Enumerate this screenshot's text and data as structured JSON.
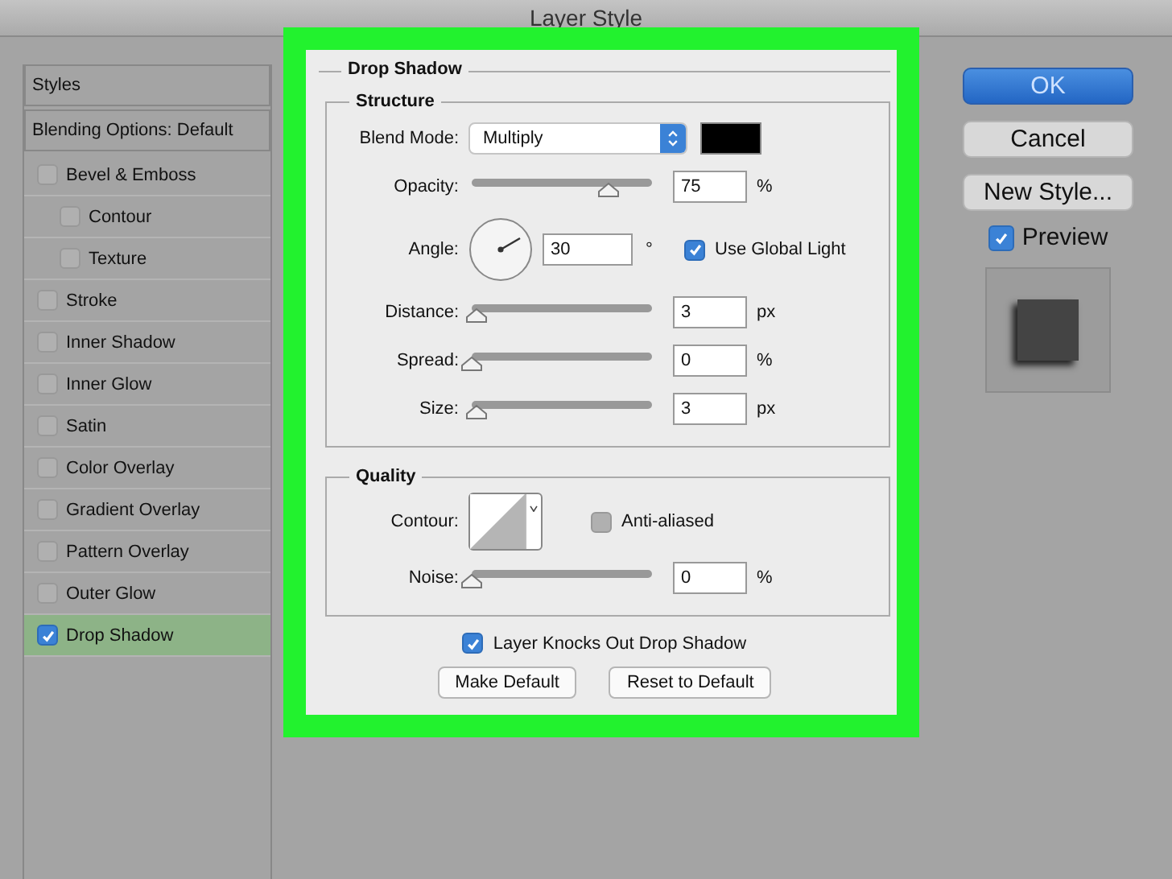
{
  "window": {
    "title": "Layer Style"
  },
  "sidebar": {
    "items": [
      {
        "label": "Styles",
        "kind": "header"
      },
      {
        "label": "Blending Options: Default",
        "kind": "header"
      },
      {
        "label": "Bevel & Emboss",
        "kind": "effect",
        "checked": false,
        "selected": false,
        "children": [
          {
            "label": "Contour",
            "kind": "effect",
            "checked": false,
            "selected": false
          },
          {
            "label": "Texture",
            "kind": "effect",
            "checked": false,
            "selected": false
          }
        ]
      },
      {
        "label": "Stroke",
        "kind": "effect",
        "checked": false,
        "selected": false
      },
      {
        "label": "Inner Shadow",
        "kind": "effect",
        "checked": false,
        "selected": false
      },
      {
        "label": "Inner Glow",
        "kind": "effect",
        "checked": false,
        "selected": false
      },
      {
        "label": "Satin",
        "kind": "effect",
        "checked": false,
        "selected": false
      },
      {
        "label": "Color Overlay",
        "kind": "effect",
        "checked": false,
        "selected": false
      },
      {
        "label": "Gradient Overlay",
        "kind": "effect",
        "checked": false,
        "selected": false
      },
      {
        "label": "Pattern Overlay",
        "kind": "effect",
        "checked": false,
        "selected": false
      },
      {
        "label": "Outer Glow",
        "kind": "effect",
        "checked": false,
        "selected": false
      },
      {
        "label": "Drop Shadow",
        "kind": "effect",
        "checked": true,
        "selected": true
      }
    ]
  },
  "drop_shadow": {
    "title": "Drop Shadow",
    "structure": {
      "title": "Structure",
      "rows": [
        {
          "kind": "select",
          "label": "Blend Mode:",
          "value": "Multiply",
          "color": "#000000"
        },
        {
          "kind": "slider",
          "label": "Opacity:",
          "level": 0.76,
          "value": "75",
          "unit": "%"
        },
        {
          "kind": "angle",
          "label": "Angle:",
          "value": "30",
          "unit": "°",
          "option": {
            "label": "Use Global Light",
            "checked": true
          }
        },
        {
          "kind": "slider",
          "label": "Distance:",
          "level": 0.03,
          "value": "3",
          "unit": "px"
        },
        {
          "kind": "slider",
          "label": "Spread:",
          "level": 0,
          "value": "0",
          "unit": "%"
        },
        {
          "kind": "slider",
          "label": "Size:",
          "level": 0.03,
          "value": "3",
          "unit": "px"
        }
      ]
    },
    "quality": {
      "title": "Quality",
      "rows": [
        {
          "kind": "contour",
          "label": "Contour:",
          "option": {
            "label": "Anti-aliased",
            "checked": false
          }
        },
        {
          "kind": "slider",
          "label": "Noise:",
          "level": 0,
          "value": "0",
          "unit": "%"
        }
      ]
    },
    "knockout": {
      "label": "Layer Knocks Out Drop Shadow",
      "checked": true
    },
    "buttons": [
      "Make Default",
      "Reset to Default"
    ]
  },
  "actions": {
    "buttons": [
      {
        "label": "OK",
        "kind": "primary"
      },
      {
        "label": "Cancel",
        "kind": "normal"
      },
      {
        "label": "New Style...",
        "kind": "normal"
      }
    ],
    "preview": {
      "label": "Preview",
      "checked": true
    }
  }
}
